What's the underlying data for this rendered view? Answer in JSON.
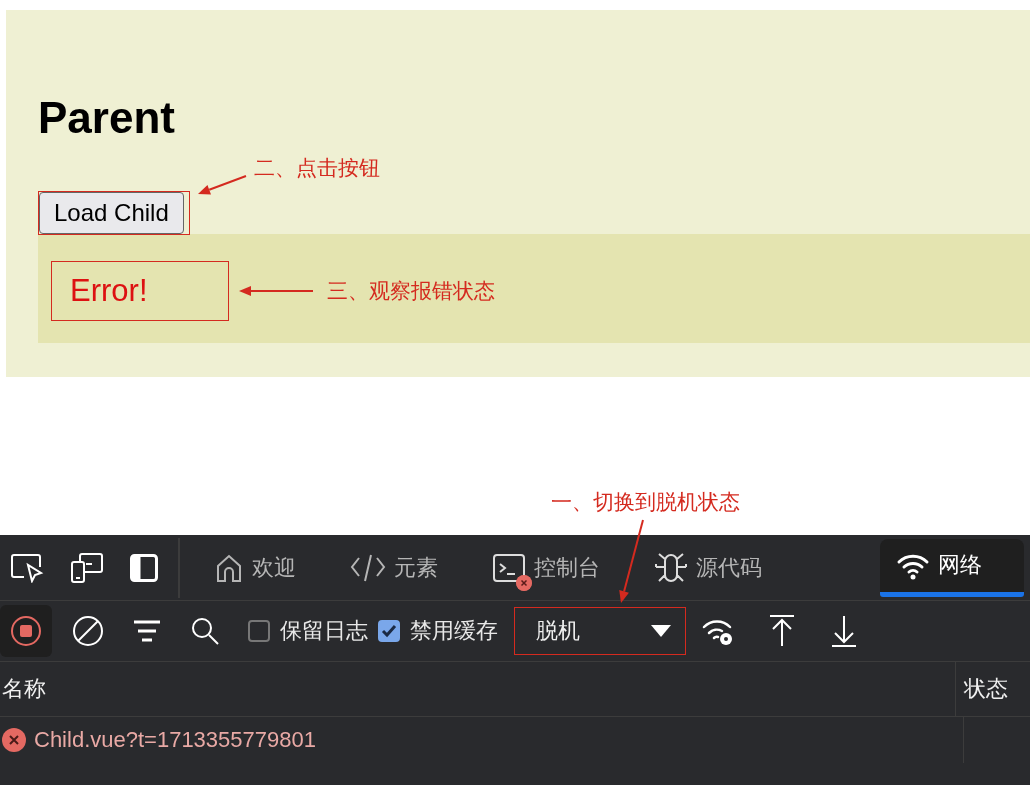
{
  "page": {
    "heading": "Parent",
    "load_button": "Load Child",
    "child": {
      "error_text": "Error!"
    }
  },
  "annotations": [
    {
      "text": "二、点击按钮"
    },
    {
      "text": "三、观察报错状态"
    },
    {
      "text": "一、切换到脱机状态"
    }
  ],
  "devtools": {
    "tabs": [
      {
        "label": "欢迎",
        "selected": false,
        "has_error": false
      },
      {
        "label": "元素",
        "selected": false,
        "has_error": false
      },
      {
        "label": "控制台",
        "selected": false,
        "has_error": true
      },
      {
        "label": "源代码",
        "selected": false,
        "has_error": false
      },
      {
        "label": "网络",
        "selected": true,
        "has_error": false
      }
    ],
    "toolbar": {
      "recording": true,
      "checkboxes": [
        {
          "label": "保留日志",
          "checked": false
        },
        {
          "label": "禁用缓存",
          "checked": true
        }
      ],
      "throttling": "脱机"
    },
    "table": {
      "columns": [
        "名称",
        "状态"
      ],
      "rows": [
        {
          "name": "Child.vue?t=1713355779801",
          "failed": true
        }
      ]
    }
  }
}
